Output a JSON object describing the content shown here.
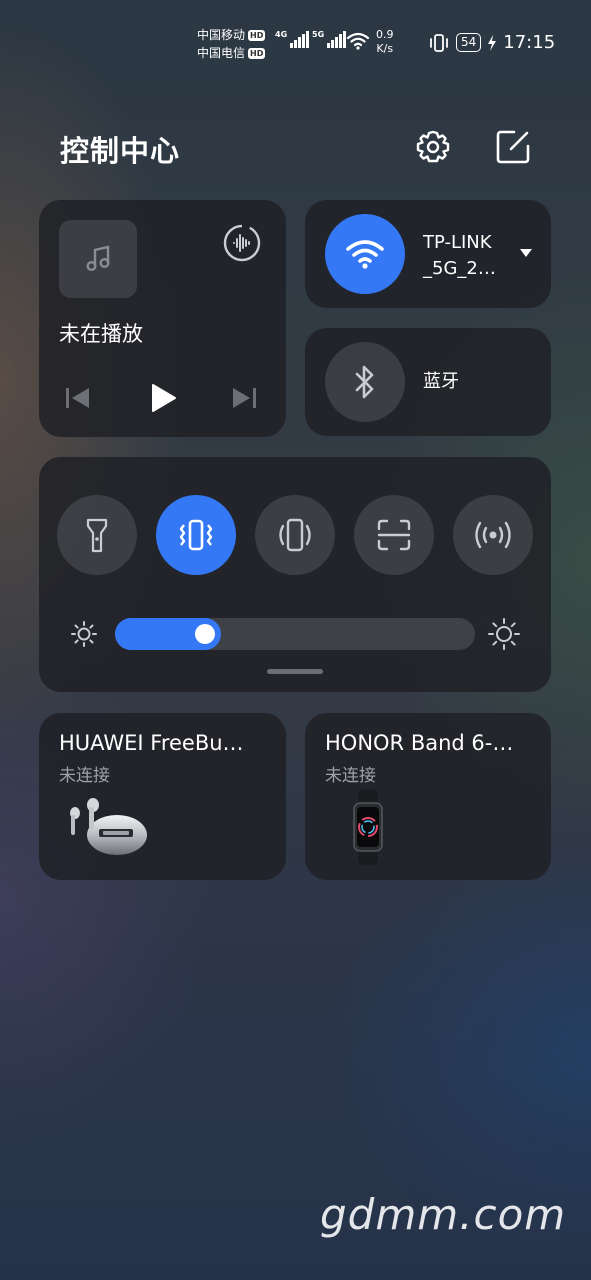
{
  "status_bar": {
    "carrier1": "中国移动",
    "carrier2": "中国电信",
    "hd_badge": "HD",
    "sim1_network": "4G",
    "sim2_network": "5G",
    "net_speed_value": "0.9",
    "net_speed_unit": "K/s",
    "battery_level": "54",
    "time": "17:15"
  },
  "header": {
    "title": "控制中心",
    "settings_icon": "gear-icon",
    "edit_icon": "edit-icon"
  },
  "media": {
    "status": "未在播放",
    "art_icon": "music-note-icon",
    "output_icon": "audio-output-icon"
  },
  "wifi": {
    "label": "TP-LINK _5G_2…",
    "line1": "TP-LINK",
    "line2": "_5G_2…",
    "enabled": true
  },
  "bluetooth": {
    "label": "蓝牙",
    "enabled": false
  },
  "quick_toggles": [
    {
      "name": "flashlight",
      "icon": "flashlight-icon",
      "on": false
    },
    {
      "name": "vibrate",
      "icon": "vibrate-icon",
      "on": true
    },
    {
      "name": "auto-rotate",
      "icon": "rotate-icon",
      "on": false
    },
    {
      "name": "scan",
      "icon": "scan-icon",
      "on": false
    },
    {
      "name": "nfc",
      "icon": "nfc-icon",
      "on": false
    }
  ],
  "brightness": {
    "level": 0.25
  },
  "devices": [
    {
      "name": "HUAWEI FreeBu…",
      "status": "未连接",
      "icon": "earbuds-image"
    },
    {
      "name": "HONOR Band 6-…",
      "status": "未连接",
      "icon": "band-image"
    }
  ],
  "watermark": "gdmm.com",
  "colors": {
    "accent": "#3478f6",
    "card": "#1e2024"
  }
}
